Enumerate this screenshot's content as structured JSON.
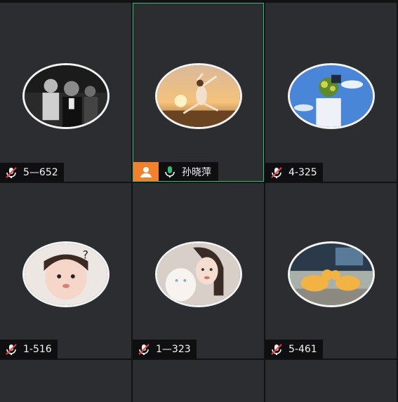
{
  "participants": [
    {
      "name": "5—652",
      "muted": true
    },
    {
      "name": "孙晓萍",
      "muted": false,
      "host": true,
      "active": true
    },
    {
      "name": "4-325",
      "muted": true
    },
    {
      "name": "1-516",
      "muted": true
    },
    {
      "name": "1—323",
      "muted": true
    },
    {
      "name": "5-461",
      "muted": true
    }
  ],
  "colors": {
    "tile_background": "#2c2d31",
    "active_border": "#2fbf71",
    "host_badge": "#f1822b",
    "mic_on": "#2fbf71",
    "mic_muted": "#e04444"
  },
  "icons": {
    "muted": "mic-muted-icon",
    "unmuted": "mic-on-icon",
    "host": "host-user-icon"
  }
}
